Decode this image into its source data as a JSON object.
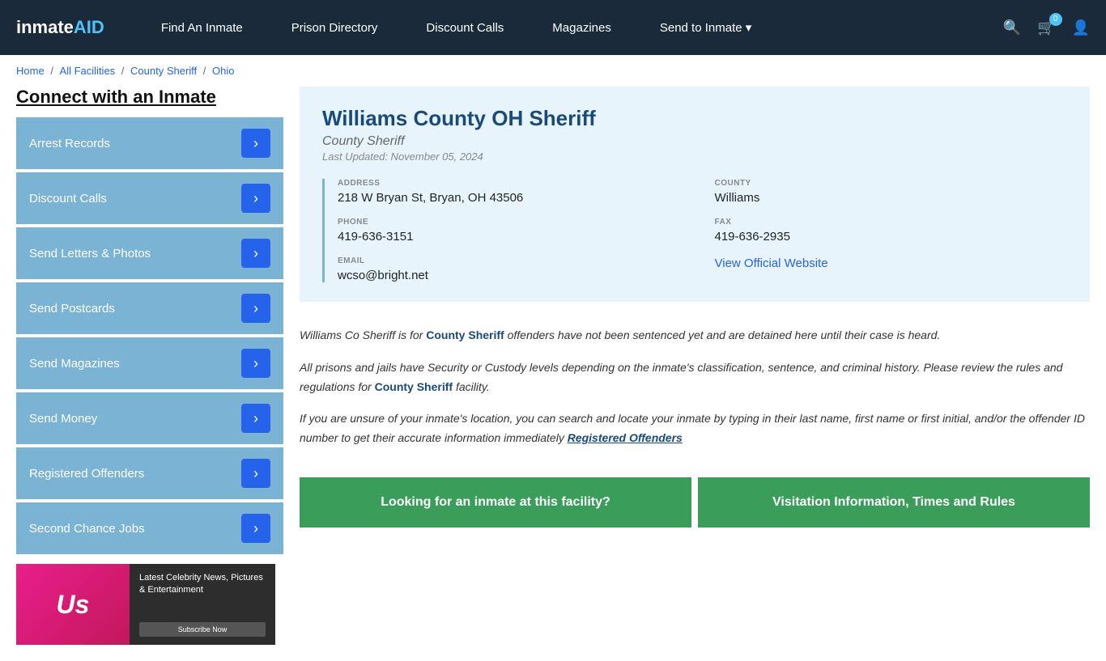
{
  "nav": {
    "logo": "inmateAID",
    "links": [
      {
        "label": "Find An Inmate",
        "id": "find-inmate"
      },
      {
        "label": "Prison Directory",
        "id": "prison-directory"
      },
      {
        "label": "Discount Calls",
        "id": "discount-calls"
      },
      {
        "label": "Magazines",
        "id": "magazines"
      },
      {
        "label": "Send to Inmate ▾",
        "id": "send-to-inmate"
      }
    ],
    "cart_count": "0"
  },
  "breadcrumb": {
    "items": [
      "Home",
      "All Facilities",
      "County Sheriff",
      "Ohio"
    ]
  },
  "sidebar": {
    "title": "Connect with an Inmate",
    "items": [
      "Arrest Records",
      "Discount Calls",
      "Send Letters & Photos",
      "Send Postcards",
      "Send Magazines",
      "Send Money",
      "Registered Offenders",
      "Second Chance Jobs"
    ],
    "ad": {
      "logo": "Us",
      "headline": "Latest Celebrity News, Pictures & Entertainment",
      "cta": "Subscribe Now"
    }
  },
  "facility": {
    "title": "Williams County OH Sheriff",
    "subtitle": "County Sheriff",
    "last_updated": "Last Updated: November 05, 2024",
    "address_label": "ADDRESS",
    "address_value": "218 W Bryan St, Bryan, OH 43506",
    "county_label": "COUNTY",
    "county_value": "Williams",
    "phone_label": "PHONE",
    "phone_value": "419-636-3151",
    "fax_label": "FAX",
    "fax_value": "419-636-2935",
    "email_label": "EMAIL",
    "email_value": "wcso@bright.net",
    "website_label": "View Official Website"
  },
  "description": {
    "p1_before": "Williams Co Sheriff is for ",
    "p1_highlight": "County Sheriff",
    "p1_after": " offenders have not been sentenced yet and are detained here until their case is heard.",
    "p2_before": "All prisons and jails have Security or Custody levels depending on the inmate's classification, sentence, and criminal history. Please review the rules and regulations for ",
    "p2_highlight": "County Sheriff",
    "p2_after": " facility.",
    "p3_before": "If you are unsure of your inmate's location, you can search and locate your inmate by typing in their last name, first name or first initial, and/or the offender ID number to get their accurate information immediately ",
    "p3_highlight": "Registered Offenders"
  },
  "buttons": {
    "looking": "Looking for an inmate at this facility?",
    "visitation": "Visitation Information, Times and Rules"
  }
}
